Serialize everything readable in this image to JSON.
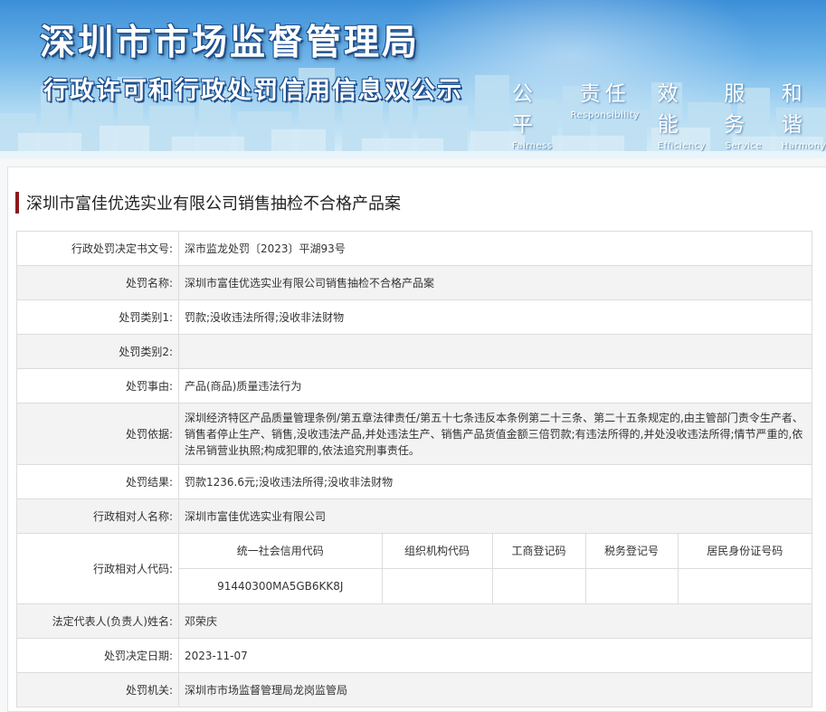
{
  "banner": {
    "title": "深圳市市场监督管理局",
    "subtitle": "行政许可和行政处罚信用信息双公示",
    "mottos": [
      {
        "cn": "公平",
        "en": "Fairness"
      },
      {
        "cn": "责任",
        "en": "Responsibility"
      },
      {
        "cn": "效能",
        "en": "Efficiency"
      },
      {
        "cn": "服务",
        "en": "Service"
      },
      {
        "cn": "和谐",
        "en": "Harmony"
      }
    ]
  },
  "case_title": "深圳市富佳优选实业有限公司销售抽检不合格产品案",
  "rows": {
    "decision_no": {
      "label": "行政处罚决定书文号:",
      "value": "深市监龙处罚〔2023〕平湖93号"
    },
    "penalty_name": {
      "label": "处罚名称:",
      "value": "深圳市富佳优选实业有限公司销售抽检不合格产品案"
    },
    "category1": {
      "label": "处罚类别1:",
      "value": "罚款;没收违法所得;没收非法财物"
    },
    "category2": {
      "label": "处罚类别2:",
      "value": ""
    },
    "reason": {
      "label": "处罚事由:",
      "value": "产品(商品)质量违法行为"
    },
    "basis": {
      "label": "处罚依据:",
      "value": "深圳经济特区产品质量管理条例/第五章法律责任/第五十七条违反本条例第二十三条、第二十五条规定的,由主管部门责令生产者、销售者停止生产、销售,没收违法产品,并处违法生产、销售产品货值金额三倍罚款;有违法所得的,并处没收违法所得;情节严重的,依法吊销营业执照;构成犯罪的,依法追究刑事责任。"
    },
    "result": {
      "label": "处罚结果:",
      "value": "罚款1236.6元;没收违法所得;没收非法财物"
    },
    "party_name": {
      "label": "行政相对人名称:",
      "value": "深圳市富佳优选实业有限公司"
    },
    "party_code": {
      "label": "行政相对人代码:",
      "headers": [
        "统一社会信用代码",
        "组织机构代码",
        "工商登记码",
        "税务登记号",
        "居民身份证号码"
      ],
      "values": [
        "91440300MA5GB6KK8J",
        "",
        "",
        "",
        ""
      ]
    },
    "legal_rep": {
      "label": "法定代表人(负责人)姓名:",
      "value": "邓荣庆"
    },
    "decision_date": {
      "label": "处罚决定日期:",
      "value": "2023-11-07"
    },
    "authority": {
      "label": "处罚机关:",
      "value": "深圳市市场监督管理局龙岗监管局"
    }
  },
  "colors": {
    "title_accent": "#8b1a1a",
    "alt_row": "#f3f3f3",
    "banner_top": "#3c8fd8"
  }
}
